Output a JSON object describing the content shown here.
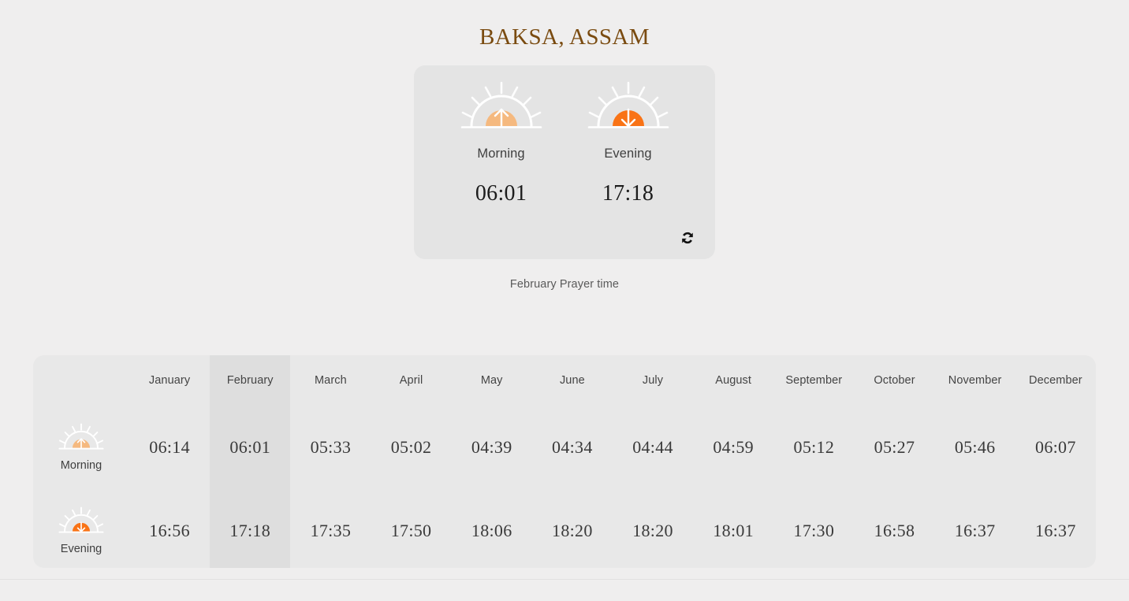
{
  "header": {
    "title": "BAKSA, ASSAM"
  },
  "summary": {
    "morning": {
      "label": "Morning",
      "time": "06:01",
      "icon": "sunrise-icon"
    },
    "evening": {
      "label": "Evening",
      "time": "17:18",
      "icon": "sunset-icon"
    },
    "refresh_icon": "refresh-icon",
    "caption": "February Prayer time"
  },
  "table": {
    "months": [
      "January",
      "February",
      "March",
      "April",
      "May",
      "June",
      "July",
      "August",
      "September",
      "October",
      "November",
      "December"
    ],
    "highlight_month": "February",
    "rows": [
      {
        "label": "Morning",
        "icon": "sunrise-icon",
        "values": [
          "06:14",
          "06:01",
          "05:33",
          "05:02",
          "04:39",
          "04:34",
          "04:44",
          "04:59",
          "05:12",
          "05:27",
          "05:46",
          "06:07"
        ]
      },
      {
        "label": "Evening",
        "icon": "sunset-icon",
        "values": [
          "16:56",
          "17:18",
          "17:35",
          "17:50",
          "18:06",
          "18:20",
          "18:20",
          "18:01",
          "17:30",
          "16:58",
          "16:37",
          "16:37"
        ]
      }
    ]
  },
  "colors": {
    "page_background": "#EFEEEE",
    "card_background": "#E4E4E4",
    "table_background": "#E8E8E8",
    "column_highlight": "#DEDEDE",
    "title_brown": "#7A4B10",
    "sunrise_orange": "#F5B97F",
    "sunset_orange": "#F97316",
    "text_dark": "#3A3A3A"
  }
}
